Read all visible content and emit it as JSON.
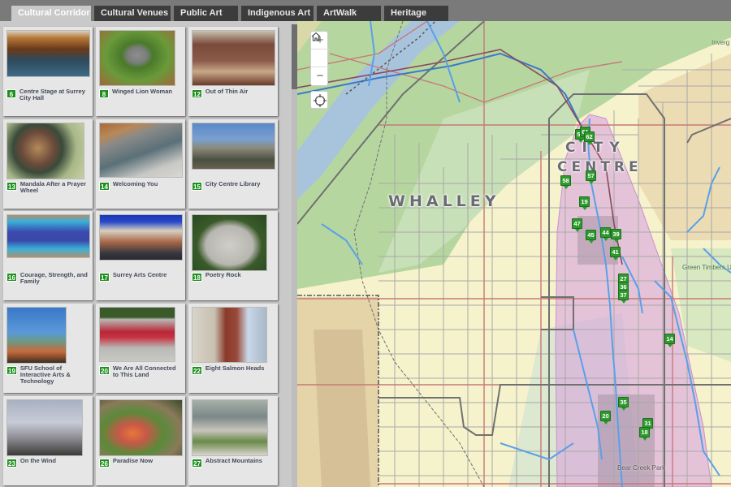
{
  "tabs": [
    {
      "label": "Cultural Corridor",
      "active": true
    },
    {
      "label": "Cultural Venues",
      "active": false
    },
    {
      "label": "Public Art",
      "active": false
    },
    {
      "label": "Indigenous Art",
      "active": false
    },
    {
      "label": "ArtWalk",
      "active": false
    },
    {
      "label": "Heritage",
      "active": false
    }
  ],
  "cards": [
    {
      "number": "6",
      "title": "Centre Stage at Surrey City Hall"
    },
    {
      "number": "8",
      "title": "Winged Lion Woman"
    },
    {
      "number": "12",
      "title": "Out of Thin Air"
    },
    {
      "number": "13",
      "title": "Mandala After a Prayer Wheel"
    },
    {
      "number": "14",
      "title": "Welcoming You"
    },
    {
      "number": "15",
      "title": "City Centre Library"
    },
    {
      "number": "16",
      "title": "Courage, Strength, and Family"
    },
    {
      "number": "17",
      "title": "Surrey Arts Centre"
    },
    {
      "number": "18",
      "title": "Poetry Rock"
    },
    {
      "number": "19",
      "title": "SFU School of Interactive Arts & Technology"
    },
    {
      "number": "20",
      "title": "We Are All Connected to This Land"
    },
    {
      "number": "22",
      "title": "Eight Salmon Heads"
    },
    {
      "number": "23",
      "title": "On the Wind"
    },
    {
      "number": "26",
      "title": "Paradise Now"
    },
    {
      "number": "27",
      "title": "Abstract Mountains"
    }
  ],
  "map": {
    "zoom_in": "+",
    "zoom_out": "−",
    "labels": {
      "whalley": "WHALLEY",
      "city": "CITY",
      "centre": "CENTRE",
      "bear_creek": "Bear Creek Park",
      "green_timbers": "Green Timbers U",
      "inverg": "Inverg"
    },
    "pins": [
      "58",
      "61",
      "62",
      "57",
      "58",
      "19",
      "47",
      "45",
      "44",
      "39",
      "41",
      "27",
      "36",
      "37",
      "14",
      "35",
      "20",
      "31",
      "18"
    ]
  },
  "colors": {
    "badge": "#1f8f1f",
    "active_tab": "#c9c9c9",
    "tab": "#3c3c3c",
    "corridor": "#d9a4e0"
  }
}
